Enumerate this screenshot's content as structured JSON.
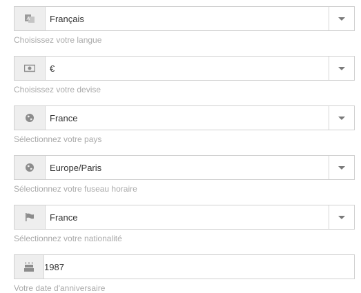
{
  "fields": [
    {
      "icon": "language-icon",
      "value": "Français",
      "help": "Choisissez votre langue"
    },
    {
      "icon": "money-icon",
      "value": "€",
      "help": "Choisissez votre devise"
    },
    {
      "icon": "globe-icon",
      "value": "France",
      "help": "Sélectionnez votre pays"
    },
    {
      "icon": "globe-icon",
      "value": "Europe/Paris",
      "help": "Sélectionnez votre fuseau horaire"
    },
    {
      "icon": "flag-icon",
      "value": "France",
      "help": "Sélectionnez votre nationalité"
    },
    {
      "icon": "birthday-cake-icon",
      "value": "1987",
      "help": "Votre date d'anniversaire"
    }
  ],
  "colors": {
    "addon_bg": "#eeeeee",
    "icon": "#8c8c8c",
    "help": "#aaaaaa",
    "border": "#cfcfcf"
  }
}
